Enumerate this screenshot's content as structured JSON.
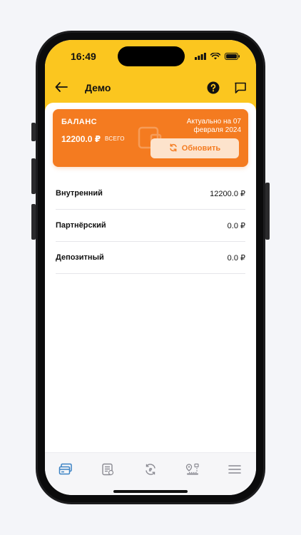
{
  "status": {
    "time": "16:49"
  },
  "header": {
    "title": "Демо"
  },
  "balance": {
    "label": "БАЛАНС",
    "amount": "12200.0 ₽",
    "total_label": "ВСЕГО",
    "updated": "Актуально на 07 февраля 2024",
    "refresh_label": "Обновить"
  },
  "accounts": [
    {
      "name": "Внутренний",
      "value": "12200.0 ₽"
    },
    {
      "name": "Партнёрский",
      "value": "0.0 ₽"
    },
    {
      "name": "Депозитный",
      "value": "0.0 ₽"
    }
  ],
  "tabs": [
    {
      "icon": "cards-icon",
      "active": true
    },
    {
      "icon": "list-icon",
      "active": false
    },
    {
      "icon": "exchange-icon",
      "active": false
    },
    {
      "icon": "route-icon",
      "active": false
    },
    {
      "icon": "menu-icon",
      "active": false
    }
  ],
  "colors": {
    "accent": "#fbc61f",
    "card": "#f47b20",
    "active_tab": "#3b82c4"
  }
}
